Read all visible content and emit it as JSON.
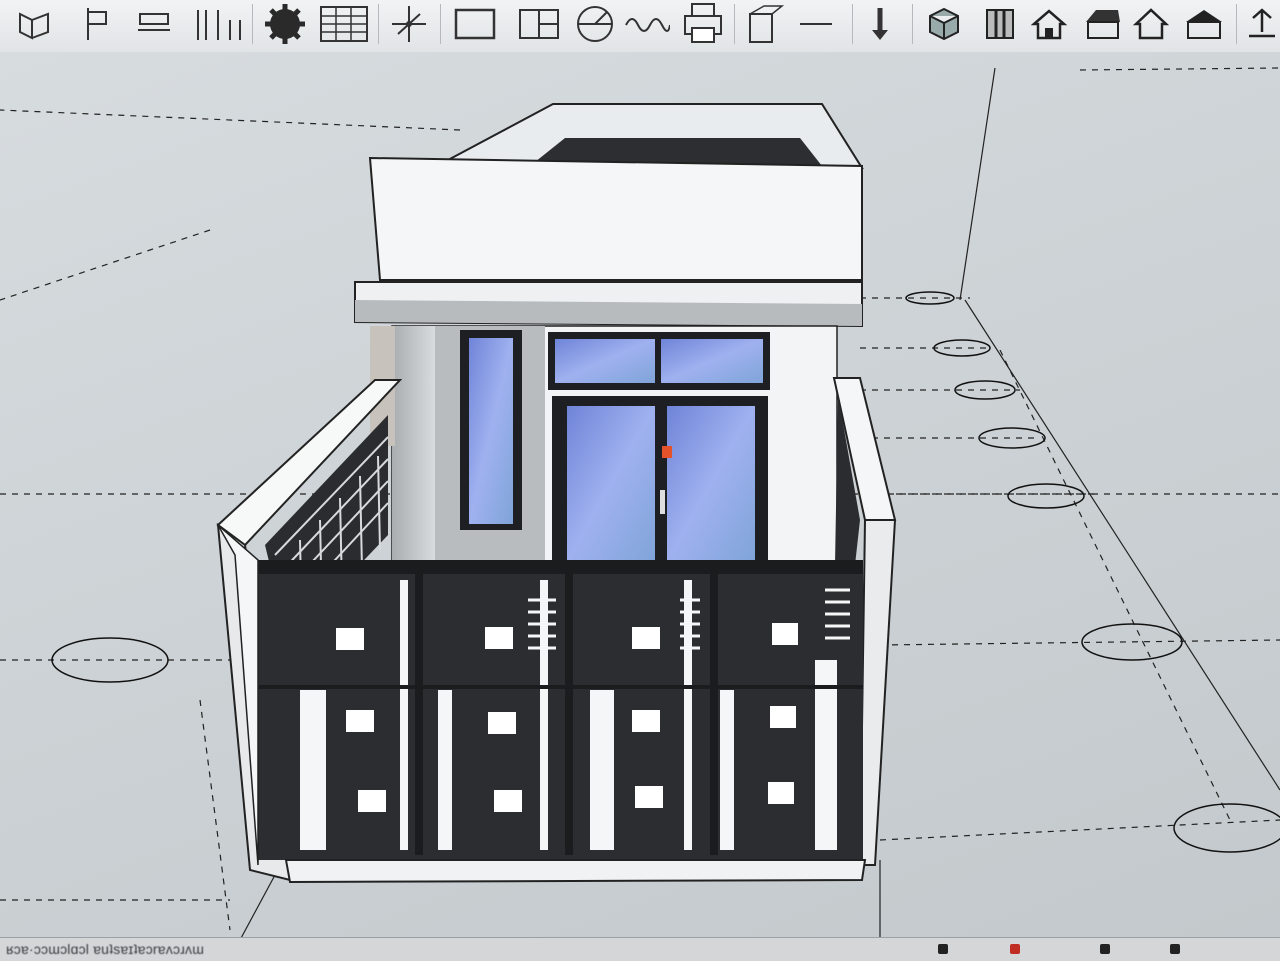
{
  "app": {
    "name": "3D modeling viewport"
  },
  "toolbar": {
    "buttons": [
      {
        "id": "views-icon"
      },
      {
        "id": "section-plane-icon"
      },
      {
        "id": "dimension-icon"
      },
      {
        "id": "wall-tool-icon"
      },
      {
        "id": "settings-gear-icon"
      },
      {
        "id": "table-grid-icon"
      },
      {
        "id": "axes-icon"
      },
      {
        "id": "rectangle-icon"
      },
      {
        "id": "window-panel-icon"
      },
      {
        "id": "protractor-icon"
      },
      {
        "id": "spring-icon"
      },
      {
        "id": "print-icon"
      },
      {
        "id": "door-icon"
      },
      {
        "id": "line-icon"
      },
      {
        "id": "push-pull-arrow-icon"
      },
      {
        "id": "component-box-icon"
      },
      {
        "id": "column-icon"
      },
      {
        "id": "house-icon"
      },
      {
        "id": "house-roof-icon"
      },
      {
        "id": "house-outline-icon"
      },
      {
        "id": "warehouse-icon"
      },
      {
        "id": "upload-icon"
      }
    ]
  },
  "statusbar": {
    "text": "ʁɔɐ·ɔɔɯɔlɑɔl ɐuʇsɐɪʇɐɔrɐʌɔɹʌɯ"
  },
  "colors": {
    "toolbar_bg": "#e8eaec",
    "ground": "#cfd4d7",
    "facade_dark": "#2b2d30",
    "glass": "#8aa3e6",
    "wall_white": "#f4f6f7"
  }
}
